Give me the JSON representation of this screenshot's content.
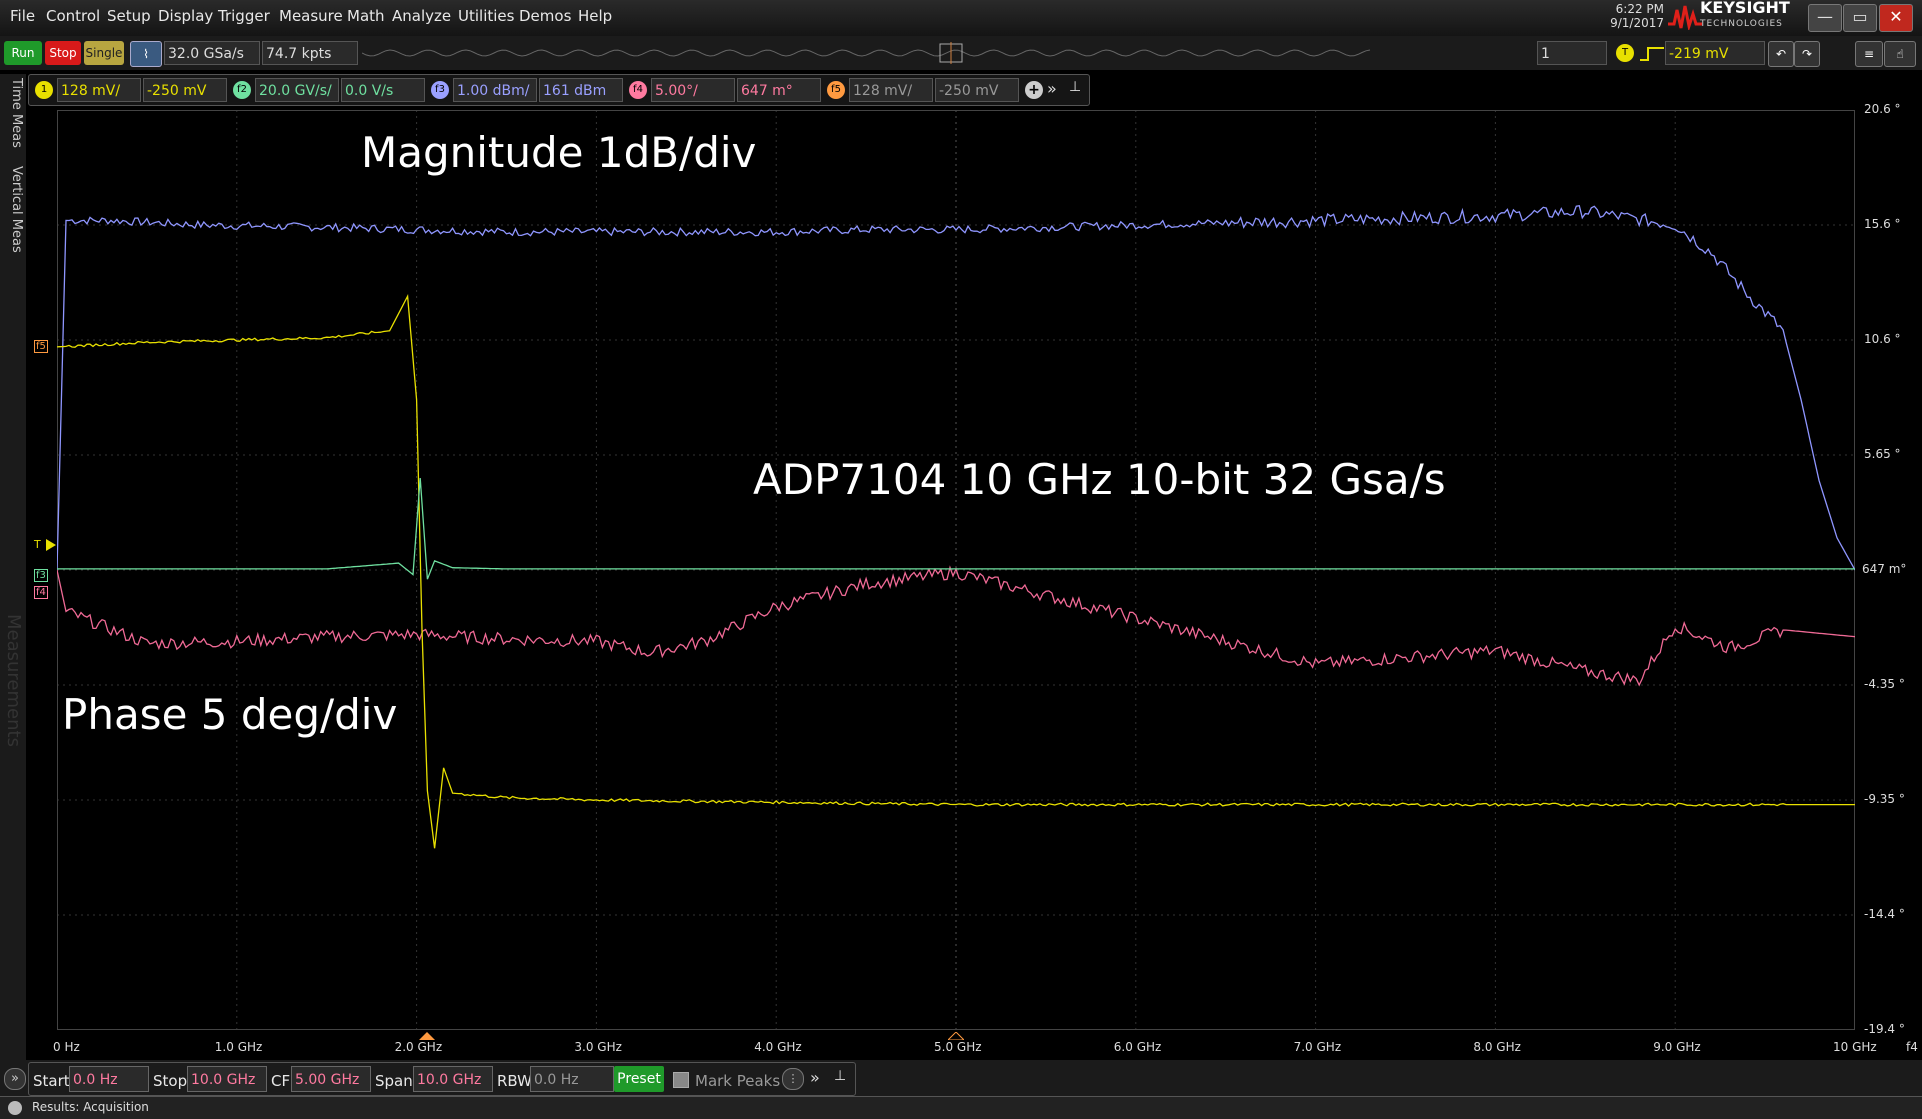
{
  "menu": [
    "File",
    "Control",
    "Setup",
    "Display",
    "Trigger",
    "Measure",
    "Math",
    "Analyze",
    "Utilities",
    "Demos",
    "Help"
  ],
  "clock": {
    "time": "6:22 PM",
    "date": "9/1/2017"
  },
  "brand": {
    "name": "KEYSIGHT",
    "sub": "TECHNOLOGIES"
  },
  "toolbar": {
    "run": "Run",
    "stop": "Stop",
    "single": "Single",
    "sample_rate": "32.0 GSa/s",
    "memory": "74.7 kpts",
    "trigger_count": "1",
    "trigger_level": "-219 mV",
    "trigger_badge": "T"
  },
  "channels": [
    {
      "id": "1",
      "scale": "128 mV/",
      "offset": "-250 mV",
      "color": "#e8e000"
    },
    {
      "id": "f2",
      "scale": "20.0 GV/s/",
      "offset": "0.0 V/s",
      "color": "#6fe0a0"
    },
    {
      "id": "f3",
      "scale": "1.00 dBm/",
      "offset": "161 dBm",
      "color": "#9aa0ff"
    },
    {
      "id": "f4",
      "scale": "5.00°/",
      "offset": "647 m°",
      "color": "#ff7aa0"
    },
    {
      "id": "f5",
      "scale": "128 mV/",
      "offset": "-250 mV",
      "color": "#ff9a40"
    }
  ],
  "left_tabs": [
    "Time Meas",
    "Vertical Meas"
  ],
  "measurements_tab": "Measurements",
  "x_ticks": [
    "0 Hz",
    "1.0 GHz",
    "2.0 GHz",
    "3.0 GHz",
    "4.0 GHz",
    "5.0 GHz",
    "6.0 GHz",
    "7.0 GHz",
    "8.0 GHz",
    "9.0 GHz",
    "10 GHz"
  ],
  "x_axis_channel": "f4",
  "y_ticks": [
    "20.6 °",
    "15.6 °",
    "10.6 °",
    "5.65 °",
    "647 m°",
    "-4.35 °",
    "-9.35 °",
    "-14.4 °",
    "-19.4 °"
  ],
  "annotations": {
    "magnitude": "Magnitude 1dB/div",
    "title": "ADP7104 10 GHz 10-bit 32 Gsa/s",
    "phase": "Phase 5 deg/div"
  },
  "markers": {
    "trigger": "T",
    "f5": "f5",
    "f3": "f3",
    "f4": "f4"
  },
  "chart_data": {
    "type": "line",
    "x_unit": "GHz",
    "xlim": [
      0,
      10
    ],
    "ylim": [
      -19.4,
      20.6
    ],
    "grid": true,
    "series": [
      {
        "color": "#8f96ff",
        "x": [
          0,
          0.05,
          0.3,
          0.8,
          1.5,
          2,
          2.5,
          3,
          3.5,
          4,
          4.5,
          5,
          5.5,
          6,
          6.5,
          7,
          7.5,
          8,
          8.5,
          9,
          9.2,
          9.4,
          9.6,
          9.7,
          9.8,
          9.9,
          10
        ],
        "y": [
          0.6,
          15.8,
          15.8,
          15.6,
          15.5,
          15.4,
          15.3,
          15.3,
          15.3,
          15.3,
          15.4,
          15.4,
          15.5,
          15.6,
          15.7,
          15.8,
          15.9,
          16.0,
          16.2,
          15.6,
          14.4,
          12.6,
          11.0,
          8.0,
          4.5,
          2.0,
          0.6
        ]
      },
      {
        "color": "#f06a96",
        "x": [
          0,
          0.05,
          0.5,
          1,
          1.5,
          2,
          2.5,
          3,
          3.3,
          3.6,
          4,
          4.5,
          5,
          5.5,
          6,
          6.5,
          7,
          7.5,
          8,
          8.5,
          8.8,
          9,
          9.3,
          9.6,
          10
        ],
        "y": [
          0.6,
          -1.2,
          -2.6,
          -2.5,
          -2.3,
          -2.2,
          -2.4,
          -2.5,
          -3.0,
          -2.5,
          -1.0,
          0.0,
          0.5,
          -0.5,
          -1.5,
          -2.5,
          -3.5,
          -3.2,
          -2.9,
          -3.8,
          -4.2,
          -1.8,
          -2.8,
          -2.0,
          -2.3
        ]
      },
      {
        "color": "#e8e000",
        "x": [
          0,
          0.5,
          1,
          1.5,
          1.85,
          1.95,
          2.0,
          2.03,
          2.06,
          2.1,
          2.15,
          2.2,
          2.5,
          3,
          4,
          5,
          6,
          7,
          8,
          9,
          10
        ],
        "y": [
          10.3,
          10.5,
          10.6,
          10.7,
          11.0,
          12.5,
          8.0,
          -2.0,
          -9.0,
          -11.5,
          -8.0,
          -9.1,
          -9.3,
          -9.4,
          -9.5,
          -9.6,
          -9.6,
          -9.6,
          -9.6,
          -9.6,
          -9.6
        ]
      },
      {
        "color": "#6fe0a0",
        "x": [
          0,
          1.5,
          1.9,
          1.98,
          2.02,
          2.06,
          2.1,
          2.2,
          2.5,
          10
        ],
        "y": [
          0.647,
          0.647,
          0.9,
          0.4,
          4.6,
          0.2,
          1.0,
          0.7,
          0.647,
          0.647
        ]
      }
    ]
  },
  "bottom": {
    "start_label": "Start",
    "start": "0.0 Hz",
    "stop_label": "Stop",
    "stop": "10.0 GHz",
    "cf_label": "CF",
    "cf": "5.00 GHz",
    "span_label": "Span",
    "span": "10.0 GHz",
    "rbw_label": "RBW",
    "rbw": "0.0 Hz",
    "preset": "Preset",
    "mark_peaks": "Mark Peaks"
  },
  "status": "Results: Acquisition"
}
